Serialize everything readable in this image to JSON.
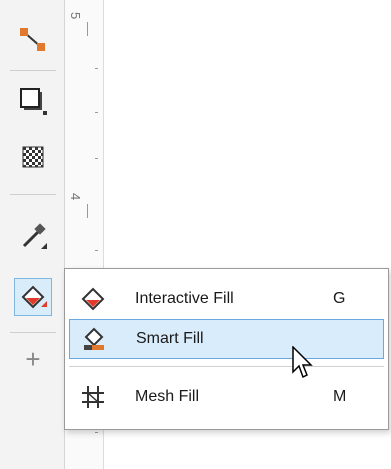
{
  "toolbox": {
    "tools": [
      {
        "name": "connector-tool-icon"
      },
      {
        "name": "drop-shadow-tool-icon"
      },
      {
        "name": "transparency-tool-icon"
      },
      {
        "name": "eyedropper-tool-icon"
      },
      {
        "name": "interactive-fill-tool-icon"
      },
      {
        "name": "add-tool-icon"
      }
    ],
    "add_label": "+"
  },
  "ruler": {
    "labels": [
      "5",
      "4"
    ]
  },
  "flyout": {
    "items": [
      {
        "label": "Interactive Fill",
        "shortcut": "G"
      },
      {
        "label": "Smart Fill",
        "shortcut": ""
      },
      {
        "label": "Mesh Fill",
        "shortcut": "M"
      }
    ]
  },
  "colors": {
    "accent": "#d9ecfb",
    "accent_border": "#6aa9dd",
    "brand_red": "#e23b2b",
    "icon_orange": "#e0782e"
  }
}
